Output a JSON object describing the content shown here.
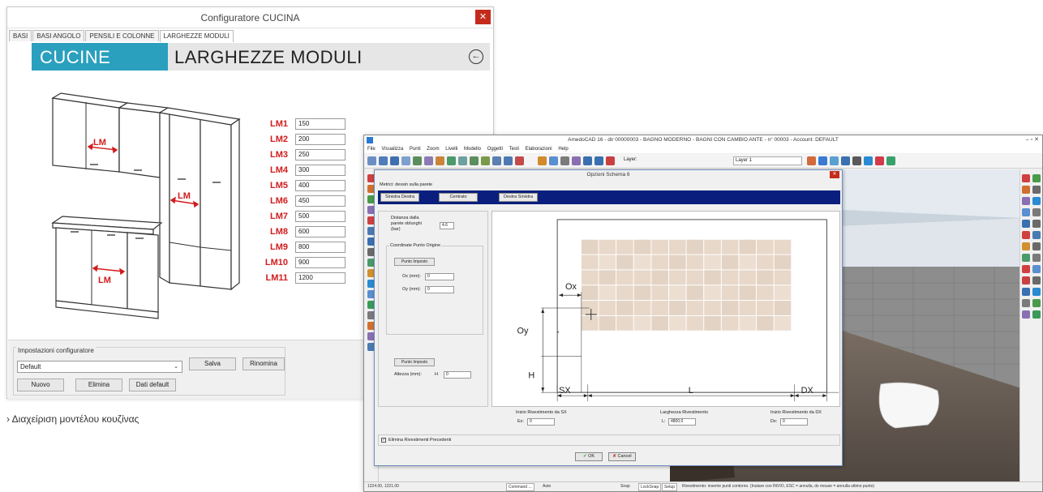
{
  "config_window": {
    "title": "Configuratore CUCINA",
    "close": "✕",
    "tabs": [
      "BASI",
      "BASI ANGOLO",
      "PENSILI E COLONNE",
      "LARGHEZZE MODULI"
    ],
    "active_tab": 3,
    "brand": "CUCINE",
    "section": "LARGHEZZE MODULI",
    "back_icon": "back-arrow-icon",
    "lm_label": "LM",
    "module_widths": [
      {
        "label": "LM1",
        "value": "150"
      },
      {
        "label": "LM2",
        "value": "200"
      },
      {
        "label": "LM3",
        "value": "250"
      },
      {
        "label": "LM4",
        "value": "300"
      },
      {
        "label": "LM5",
        "value": "400"
      },
      {
        "label": "LM6",
        "value": "450"
      },
      {
        "label": "LM7",
        "value": "500"
      },
      {
        "label": "LM8",
        "value": "600"
      },
      {
        "label": "LM9",
        "value": "800"
      },
      {
        "label": "LM10",
        "value": "900"
      },
      {
        "label": "LM11",
        "value": "1200"
      }
    ],
    "settings_group": "Impostazioni configuratore",
    "preset_value": "Default",
    "buttons": {
      "save": "Salva",
      "rename": "Rinomina",
      "new": "Nuovo",
      "delete": "Elimina",
      "defaults": "Dati default"
    },
    "accent_color": "#2aa0be",
    "lm_color": "#d21c1c"
  },
  "caption": "› Διαχείριση μοντέλου κουζίνας",
  "cad_window": {
    "title": "AmedoCAD 16 - dir 00000003 - BAGNO MODERNO - BAGNI CON CAMBIO ANTE - n° 00003 - Account: DEFAULT",
    "window_controls": "–  ▫  ✕",
    "menu": [
      "File",
      "Visualizza",
      "Punti",
      "Zoom",
      "Livelli",
      "Modello",
      "Oggetti",
      "Testi",
      "Elaborazioni",
      "Help"
    ],
    "layer_label": "Layer:",
    "layer_value": "Layer 1",
    "status": {
      "coords": "1224.00, 1221.00",
      "command": "Command ...",
      "auto": "Auto",
      "snap": "Snap",
      "lock": "LockSnap",
      "setup": "Setup",
      "message": "Rivestimento: inserire punti contorno. (Inutare con INVIO, ESC = annulla, dx mouse = annulla ultimo punto)"
    }
  },
  "dialog": {
    "title": "Opzioni Schema 6",
    "close": "✕",
    "metric_label": "Metrici: dessin sulla parete",
    "tabs": [
      "Sinistra Destra",
      "Centrato",
      "Destra Sinistra"
    ],
    "distance_label_1": "Distanza dalla",
    "distance_label_2": "parete oblunghi",
    "distance_label_3": "(bar)",
    "distance_value": "4.6",
    "origin_group": "Coordinate Punto Origine",
    "point_button": "Punto Impostо",
    "ox_label": "Ox (mm):",
    "ox_value": "0",
    "oy_label": "Oy (mm):",
    "oy_value": "0",
    "point_button_2": "Punto Impostо",
    "height_label": "Altezza (mm):",
    "height_symbol": "H",
    "height_value": "0",
    "diagram_labels": {
      "ox": "Ox",
      "oy": "Oy",
      "h": "H",
      "sx": "SX",
      "l": "L",
      "dx": "DX"
    },
    "sx_label": "Inizio Rivestimento da SX",
    "sx_field": "Ex:",
    "sx_value": "0",
    "l_label": "Larghezza Rivestimento",
    "l_field": "L:",
    "l_value": "4800.0",
    "dx_label": "Inizio Rivestimento da DX",
    "dx_field": "Dx:",
    "dx_value": "0",
    "checkbox_label": "Elimina Rivestimenti Precedenti",
    "ok": "OK",
    "cancel": "Cancel"
  }
}
